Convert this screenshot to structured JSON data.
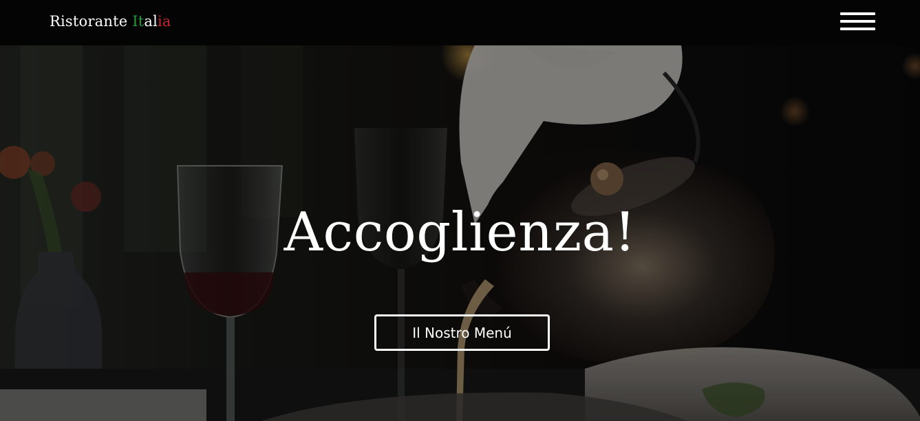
{
  "header": {
    "brand": {
      "part1": "Ristorante ",
      "part2": "It",
      "part3": "al",
      "part4": "ia"
    },
    "menu_icon": "hamburger-menu-icon"
  },
  "hero": {
    "title": "Accoglienza!",
    "button_label": "Il Nostro Menú"
  },
  "colors": {
    "navbar": "#050405",
    "brand_green": "#1f9d3a",
    "brand_white": "#ffffff",
    "brand_red": "#c4262e"
  }
}
